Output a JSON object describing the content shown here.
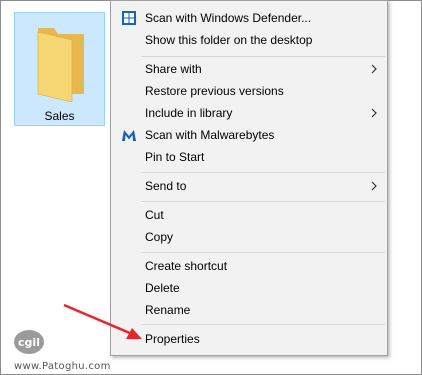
{
  "folder": {
    "name": "Sales",
    "icon": "folder-icon",
    "selection_color": "#cce8ff"
  },
  "context_menu": {
    "items": [
      {
        "label": "Scan with Windows Defender...",
        "icon": "windows-defender-icon"
      },
      {
        "label": "Show this folder on the desktop"
      },
      {
        "label": "Share with",
        "submenu": true
      },
      {
        "label": "Restore previous versions"
      },
      {
        "label": "Include in library",
        "submenu": true
      },
      {
        "label": "Scan with Malwarebytes",
        "icon": "malwarebytes-icon"
      },
      {
        "label": "Pin to Start"
      },
      {
        "label": "Send to",
        "submenu": true
      },
      {
        "label": "Cut"
      },
      {
        "label": "Copy"
      },
      {
        "label": "Create shortcut"
      },
      {
        "label": "Delete"
      },
      {
        "label": "Rename"
      },
      {
        "label": "Properties"
      }
    ]
  },
  "annotation": {
    "color": "#e8262a",
    "points_to": "Properties"
  },
  "watermark": {
    "logo_text": "cgil",
    "site": "www.Patoghu.com"
  }
}
